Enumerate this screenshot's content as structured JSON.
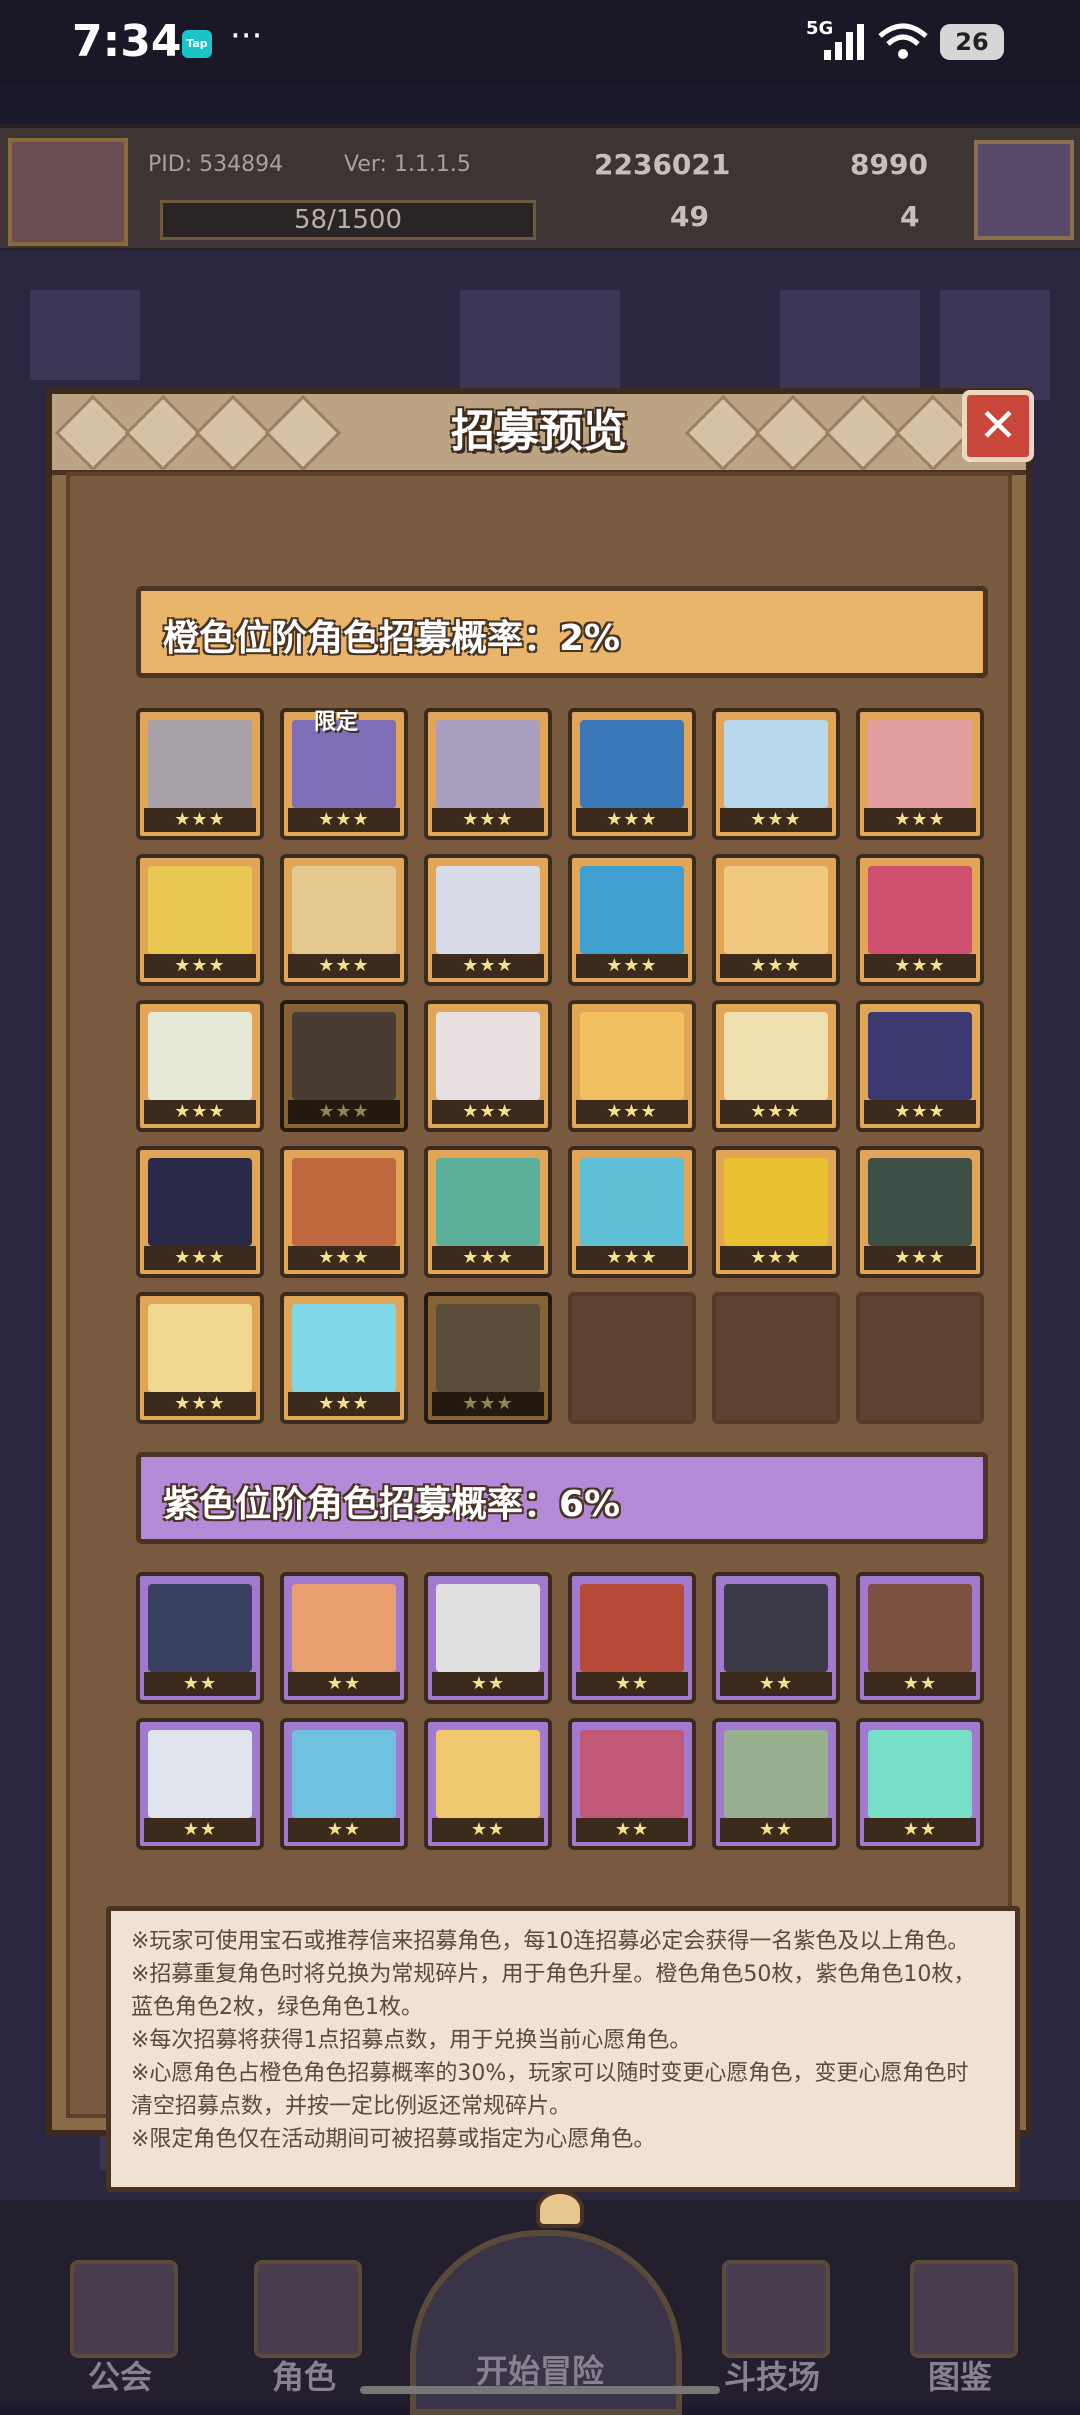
{
  "status_bar": {
    "time": "7:34",
    "tap_label": "Tap",
    "dots": "···",
    "network": "5G",
    "battery": "26"
  },
  "hud": {
    "pid": "PID: 534894",
    "version": "Ver: 1.1.1.5",
    "gold": "2236021",
    "gems": "8990",
    "stamina": "58/1500",
    "clover": "49",
    "tickets": "4"
  },
  "dialog": {
    "title": "招募预览",
    "close_label": "✕",
    "orange_section_title": "橙色位阶角色招募概率：2%",
    "purple_section_title": "紫色位阶角色招募概率：6%",
    "orange_stars": "★★★",
    "purple_stars": "★★",
    "limited_tag": "限定",
    "orange_cards": [
      {
        "color": "#a8a2a8"
      },
      {
        "color": "#7e6eb8",
        "tag": true
      },
      {
        "color": "#a9a0c0"
      },
      {
        "color": "#3b78b8"
      },
      {
        "color": "#b8d8ec"
      },
      {
        "color": "#e4a0a0"
      },
      {
        "color": "#e8c850"
      },
      {
        "color": "#e4c890"
      },
      {
        "color": "#d8dce8"
      },
      {
        "color": "#3fa0d0"
      },
      {
        "color": "#f0c880"
      },
      {
        "color": "#d05070"
      },
      {
        "color": "#e8e8d8"
      },
      {
        "color": "#7a6458",
        "dim": true
      },
      {
        "color": "#e8e0e0"
      },
      {
        "color": "#f0c060"
      },
      {
        "color": "#f0e0b0"
      },
      {
        "color": "#3a3a70"
      },
      {
        "color": "#2a2a48"
      },
      {
        "color": "#c06840"
      },
      {
        "color": "#5ab098"
      },
      {
        "color": "#60c0d8"
      },
      {
        "color": "#e8c030"
      },
      {
        "color": "#3c5048"
      },
      {
        "color": "#f0d890"
      },
      {
        "color": "#80d8e8"
      },
      {
        "color": "#9a8060",
        "dim": true
      }
    ],
    "purple_cards": [
      {
        "color": "#3a4060"
      },
      {
        "color": "#e8a070"
      },
      {
        "color": "#e0e0e0"
      },
      {
        "color": "#b84a38"
      },
      {
        "color": "#3a3a48"
      },
      {
        "color": "#7a5040"
      },
      {
        "color": "#e0e4ec"
      },
      {
        "color": "#70c0e0"
      },
      {
        "color": "#f0c870"
      },
      {
        "color": "#c05878"
      },
      {
        "color": "#98b090"
      },
      {
        "color": "#78e0c8"
      }
    ],
    "notes": [
      "※玩家可使用宝石或推荐信来招募角色，每10连招募必定会获得一名紫色及以上角色。",
      "※招募重复角色时将兑换为常规碎片，用于角色升星。橙色角色50枚，紫色角色10枚，",
      "蓝色角色2枚，绿色角色1枚。",
      "※每次招募将获得1点招募点数，用于兑换当前心愿角色。",
      "※心愿角色占橙色角色招募概率的30%，玩家可以随时变更心愿角色，变更心愿角色时",
      "清空招募点数，并按一定比例返还常规碎片。",
      "※限定角色仅在活动期间可被招募或指定为心愿角色。"
    ]
  },
  "bottom_nav": {
    "guild": "公会",
    "characters": "角色",
    "adventure": "开始冒险",
    "arena": "斗技场",
    "codex": "图鉴"
  }
}
